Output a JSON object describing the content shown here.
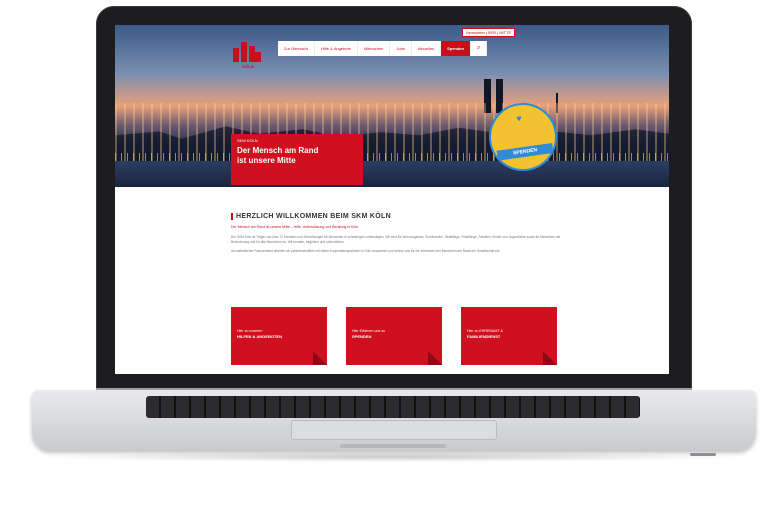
{
  "site": {
    "logo_text": "KÖLN",
    "top_link": "Newsletter | BFB | MITTE",
    "nav": [
      "Zur Übersicht",
      "Hilfe & Angebote",
      "Mitmachen",
      "Jobs",
      "Aktuelles",
      "Spenden"
    ],
    "search_icon": "search-icon",
    "hero": {
      "kicker": "SKM KÖLN",
      "title_line1": "Der Mensch am Rand",
      "title_line2": "ist unsere Mitte"
    },
    "badge": {
      "label": "SPENDEN",
      "icon": "heart-icon"
    },
    "welcome": {
      "heading": "HERZLICH WILLKOMMEN BEIM SKM KÖLN",
      "subline": "Der Mensch am Rand ist unsere Mitte – Hilfe, Unterstützung und Beratung in Köln",
      "paragraph1": "Der SKM Köln ist Träger von über 70 Diensten und Einrichtungen für Menschen in schwierigen Lebenslagen. Wir sind für Wohnungslose, Suchtkranke, Straffällige, Flüchtlinge, Familien, Kinder und Jugendliche sowie für Menschen mit Behinderung und für alte Menschen da. Wir beraten, begleiten und unterstützen.",
      "paragraph2": "Als katholischer Fachverband arbeiten wir partnerschaftlich mit vielen Kooperationspartnern in Köln zusammen und setzen uns für die Interessen der Menschen am Rand der Gesellschaft ein."
    },
    "tiles": [
      {
        "pre": "Hier zu unseren",
        "main": "HILFEN & ANGEBOTEN"
      },
      {
        "pre": "Hier Erfahren und zu",
        "main": "SPENDEN"
      },
      {
        "pre": "Hier zu EHRENAMT &",
        "main": "FAMILIENDIENST"
      }
    ]
  },
  "colors": {
    "brand": "#c80f1e",
    "badge_yellow": "#f2c230",
    "badge_blue": "#2f8bd3",
    "laptop_frame": "#1d1d1f"
  }
}
